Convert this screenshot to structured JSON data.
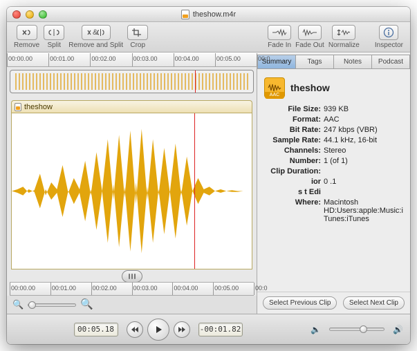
{
  "window": {
    "title": "theshow.m4r"
  },
  "toolbar": {
    "remove": "Remove",
    "split": "Split",
    "remove_split": "Remove and Split",
    "crop": "Crop",
    "fade_in": "Fade In",
    "fade_out": "Fade Out",
    "normalize": "Normalize",
    "inspector": "Inspector"
  },
  "timeline": {
    "ticks": [
      "00:00.00",
      "00:01.00",
      "00:02.00",
      "00:03.00",
      "00:04.00",
      "00:05.00",
      "00:0"
    ],
    "bottom_ticks": [
      "00:00.00",
      "00:01.00",
      "00:02.00",
      "00:03.00",
      "00:04.00",
      "00:05.00",
      "00:0"
    ]
  },
  "clip": {
    "name": "theshow"
  },
  "inspector": {
    "tabs": [
      "Summary",
      "Tags",
      "Notes",
      "Podcast"
    ],
    "active_tab": 0,
    "title": "theshow",
    "icon_label": "AAC",
    "meta": [
      {
        "k": "File Size:",
        "v": "939 KB"
      },
      {
        "k": "Format:",
        "v": "AAC"
      },
      {
        "k": "Bit Rate:",
        "v": "247 kbps (VBR)"
      },
      {
        "k": "Sample Rate:",
        "v": "44.1 kHz, 16-bit"
      },
      {
        "k": "Channels:",
        "v": "Stereo"
      },
      {
        "k": "Number:",
        "v": "1 (of 1)"
      },
      {
        "k": "Clip Duration:",
        "v": ""
      },
      {
        "k": "ior",
        "v": "0 .1"
      },
      {
        "k": "s  t Edi",
        "v": " "
      },
      {
        "k": "Where:",
        "v": "Macintosh HD:Users:apple:Music:iTunes:iTunes"
      }
    ],
    "prev_btn": "Select Previous Clip",
    "next_btn": "Select Next Clip"
  },
  "controls": {
    "position": "00:05.18",
    "remaining": "-00:01.82"
  }
}
